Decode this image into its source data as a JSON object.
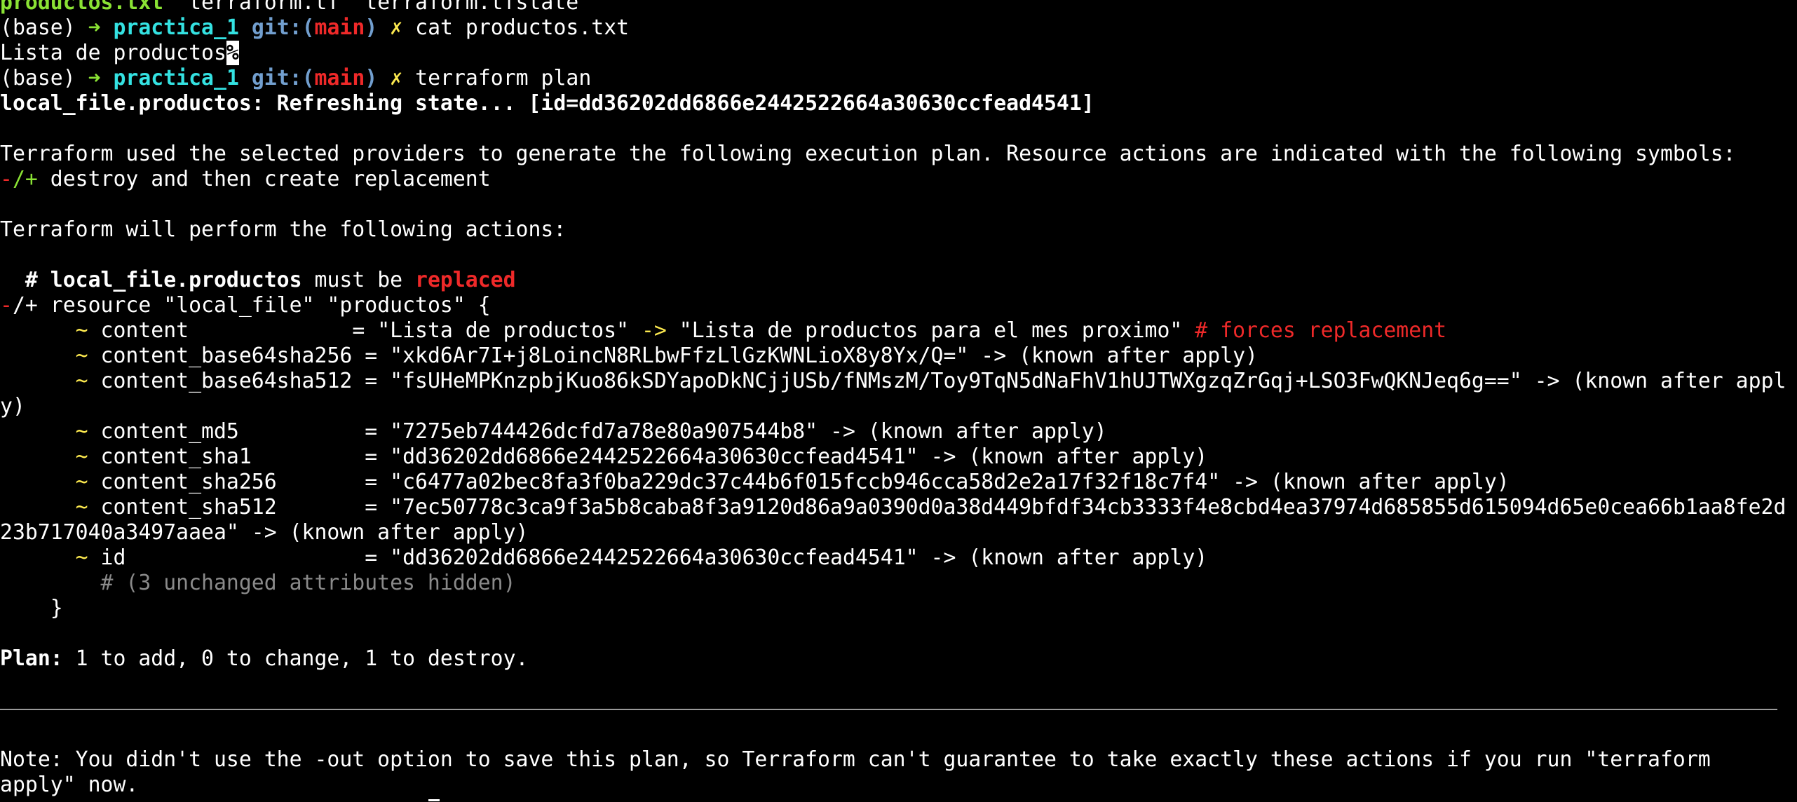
{
  "colors": {
    "background": "#000000",
    "foreground": "#ffffff",
    "green": "#8ae234",
    "cyan": "#34e2e2",
    "blue": "#729fcf",
    "red": "#ef2929",
    "yellow": "#fce94f",
    "gray": "#8a8a8a"
  },
  "ls": {
    "files": [
      "productos.txt",
      "terraform.tf",
      "terraform.tfstate"
    ],
    "sep": "  "
  },
  "prompt": {
    "env": "(base) ",
    "arrow": "➜",
    "dir": "practica_1",
    "git_open": "git:(",
    "branch": "main",
    "git_close": ")",
    "dirty": "✗"
  },
  "commands": {
    "first": "cat productos.txt",
    "second": "terraform plan"
  },
  "cat_output": {
    "text": "Lista de productos",
    "eol_mark": "%"
  },
  "refresh": {
    "text": "local_file.productos: Refreshing state... [id=dd36202dd6866e2442522664a30630ccfead4541]"
  },
  "plan_intro": {
    "line1": "Terraform used the selected providers to generate the following execution plan. Resource actions are indicated with the following symbols:",
    "symbol_minus": "-",
    "symbol_rest": "/+",
    "symbol_desc": " destroy and then create replacement",
    "line3": "Terraform will perform the following actions:"
  },
  "resource": {
    "hash": "  # ",
    "address": "local_file.productos",
    "must_be": " must be ",
    "action": "replaced",
    "decl_minus": "-",
    "decl_rest": "/+ resource \"local_file\" \"productos\" {",
    "close": "    }"
  },
  "attributes": {
    "indent": "      ",
    "tilde": "~",
    "content": {
      "name": " content             ",
      "old": "= \"Lista de productos\" ",
      "arrow": "->",
      "new": " \"Lista de productos para el mes proximo\" ",
      "forces": "# forces replacement"
    },
    "b64sha256": {
      "name": " content_base64sha256 ",
      "value": "= \"xkd6Ar7I+j8LoincN8RLbwFfzLlGzKWNLioX8y8Yx/Q=\" -> (known after apply)"
    },
    "b64sha512": {
      "name": " content_base64sha512 ",
      "value": "= \"fsUHeMPKnzpbjKuo86kSDYapoDkNCjjUSb/fNMszM/Toy9TqN5dNaFhV1hUJTWXgzqZrGqj+LSO3FwQKNJeq6g==\" -> (known after appl",
      "wrap": "y)"
    },
    "md5": {
      "name": " content_md5          ",
      "value": "= \"7275eb744426dcfd7a78e80a907544b8\" -> (known after apply)"
    },
    "sha1": {
      "name": " content_sha1         ",
      "value": "= \"dd36202dd6866e2442522664a30630ccfead4541\" -> (known after apply)"
    },
    "sha256": {
      "name": " content_sha256       ",
      "value": "= \"c6477a02bec8fa3f0ba229dc37c44b6f015fccb946cca58d2e2a17f32f18c7f4\" -> (known after apply)"
    },
    "sha512": {
      "name": " content_sha512       ",
      "value": "= \"7ec50778c3ca9f3a5b8caba8f3a9120d86a9a0390d0a38d449bfdf34cb3333f4e8cbd4ea37974d685855d615094d65e0cea66b1aa8fe2d",
      "wrap": "23b717040a3497aaea\" -> (known after apply)"
    },
    "id": {
      "name": " id                   ",
      "value": "= \"dd36202dd6866e2442522664a30630ccfead4541\" -> (known after apply)"
    },
    "hidden": "        # (3 unchanged attributes hidden)"
  },
  "plan_summary": {
    "label": "Plan:",
    "text": " 1 to add, 0 to change, 1 to destroy."
  },
  "note": {
    "line1": "Note: You didn't use the -out option to save this plan, so Terraform can't guarantee to take exactly these actions if you run \"terraform",
    "line2": "apply\" now."
  }
}
